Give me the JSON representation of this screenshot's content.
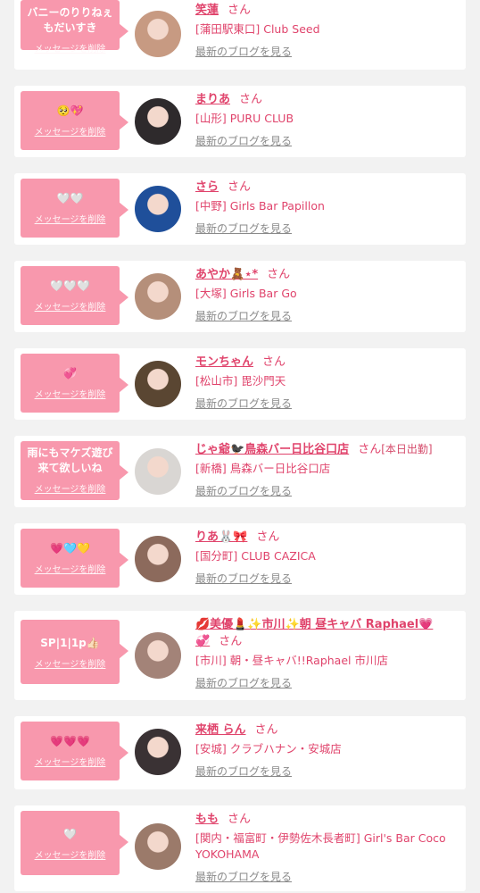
{
  "entries": [
    {
      "message": "バニーのりりねぇ\nもだいすき",
      "delete_label": "メッセージを削除",
      "name": "笑蓮",
      "san": "さん",
      "badge": "",
      "shop": "[蒲田駅東口] Club Seed",
      "blog_label": "最新のブログを見る",
      "avatar_color": "#c79a82"
    },
    {
      "message": "🥺💖",
      "delete_label": "メッセージを削除",
      "name": "まりあ",
      "san": "さん",
      "badge": "",
      "shop": "[山形] PURU CLUB",
      "blog_label": "最新のブログを見る",
      "avatar_color": "#2e2a2c"
    },
    {
      "message": "🤍🤍",
      "delete_label": "メッセージを削除",
      "name": "さら",
      "san": "さん",
      "badge": "",
      "shop": "[中野] Girls Bar Papillon",
      "blog_label": "最新のブログを見る",
      "avatar_color": "#1f4f9a"
    },
    {
      "message": "🤍🤍🤍",
      "delete_label": "メッセージを削除",
      "name": "あやか🧸⋆*",
      "san": "さん",
      "badge": "",
      "shop": "[大塚] Girls Bar Go",
      "blog_label": "最新のブログを見る",
      "avatar_color": "#b58f7a"
    },
    {
      "message": "💞",
      "delete_label": "メッセージを削除",
      "name": "モンちゃん",
      "san": "さん",
      "badge": "",
      "shop": "[松山市] 毘沙門天",
      "blog_label": "最新のブログを見る",
      "avatar_color": "#5a4632"
    },
    {
      "message": "雨にもマケズ遊び\n来て欲しいね",
      "delete_label": "メッセージを削除",
      "name": "じゃ爺🐦‍⬛鳥森バー日比谷口店",
      "san": "さん",
      "badge": "[本日出勤]",
      "shop": "[新橋] 鳥森バー日比谷口店",
      "blog_label": "最新のブログを見る",
      "avatar_color": "#d9d6d3"
    },
    {
      "message": "💗🩵💛",
      "delete_label": "メッセージを削除",
      "name": "りあ🐰🎀",
      "san": "さん",
      "badge": "",
      "shop": "[国分町] CLUB CAZICA",
      "blog_label": "最新のブログを見る",
      "avatar_color": "#8c6a5c"
    },
    {
      "message": "SP|1|1p👍🏻",
      "delete_label": "メッセージを削除",
      "name": "💋美優💄✨市川✨朝 昼キャバ Raphael💗\n💞",
      "san": "さん",
      "badge": "",
      "shop": "[市川] 朝・昼キャバ!!Raphael 市川店",
      "blog_label": "最新のブログを見る",
      "avatar_color": "#a38378"
    },
    {
      "message": "💗💗💗",
      "delete_label": "メッセージを削除",
      "name": "来栖 らん",
      "san": "さん",
      "badge": "",
      "shop": "[安城] クラブハナン・安城店",
      "blog_label": "最新のブログを見る",
      "avatar_color": "#3a3234"
    },
    {
      "message": "🤍",
      "delete_label": "メッセージを削除",
      "name": "もも",
      "san": "さん",
      "badge": "",
      "shop": "[関内・福富町・伊勢佐木長者町] Girl's Bar Coco YOKOHAMA",
      "blog_label": "最新のブログを見る",
      "avatar_color": "#9b7a6a"
    }
  ]
}
